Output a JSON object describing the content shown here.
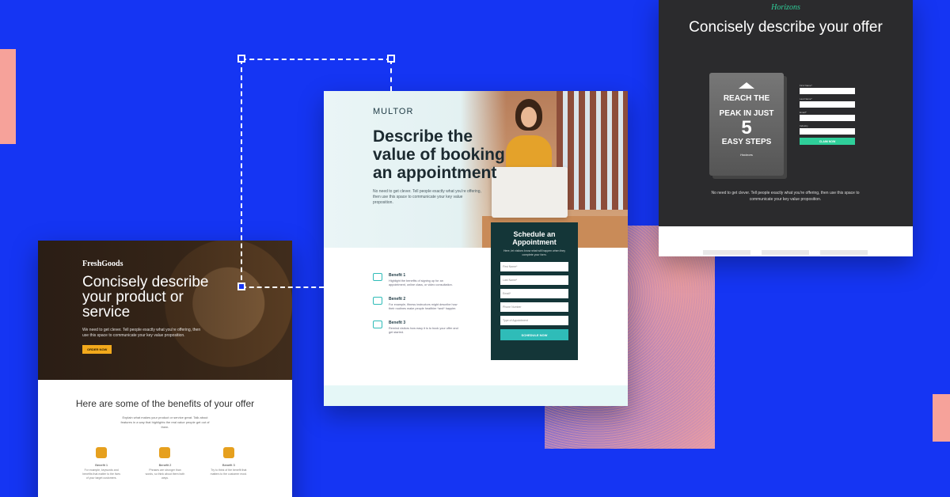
{
  "fresh": {
    "logo": "FreshGoods",
    "title": "Concisely describe your product or service",
    "subtitle": "We need to get clever. Tell people exactly what you're offering, then use this space to communicate your key value proposition.",
    "cta": "ORDER NOW",
    "benefits_heading": "Here are some of the benefits of your offer",
    "benefits_text": "Explain what makes your product or service great. Talk about features in a way that highlights the real value people get out of them.",
    "benefits": [
      {
        "title": "Benefit 1",
        "text": "For example, keywords and benefits that matter to the lives of your target customers."
      },
      {
        "title": "Benefit 2",
        "text": "Phrases are stronger than words, so think about them both ways."
      },
      {
        "title": "Benefit 3",
        "text": "Try to think of the benefit that matters to the customer most."
      }
    ]
  },
  "multor": {
    "logo": "MULTOR",
    "title": "Describe the value of booking an appointment",
    "subtitle": "No need to get clever. Tell people exactly what you're offering, then use this space to communicate your key value proposition.",
    "benefits": [
      {
        "title": "Benefit 1",
        "text": "Highlight the benefits of signing up for an appointment, online class, or video consultation."
      },
      {
        "title": "Benefit 2",
        "text": "For example, fitness instructors might describe how their routines make people healthier *and* happier."
      },
      {
        "title": "Benefit 3",
        "text": "Remind visitors how easy it is to book your offer and get started."
      }
    ],
    "form": {
      "title": "Schedule an Appointment",
      "subtitle": "Here, let visitors know what will happen when they complete your form.",
      "fields": [
        "First Name*",
        "Last Name*",
        "Email*",
        "Phone Number",
        "Type of Appointment"
      ],
      "button": "SCHEDULE NOW"
    }
  },
  "horizons": {
    "logo": "Horizons",
    "title": "Concisely describe your offer",
    "book": {
      "line1": "REACH THE",
      "line2": "PEAK IN JUST",
      "number": "5",
      "line3": "EASY STEPS",
      "brand": "Horizons"
    },
    "form": {
      "fields": [
        "First Name*",
        "Last Name*",
        "Email*",
        "Industry"
      ],
      "button": "CLAIM NOW"
    },
    "subtitle": "No need to get clever. Tell people exactly what you're offering, then use this space to communicate your key value proposition."
  },
  "colors": {
    "background": "#1535f3",
    "accent": "#f6a29a",
    "teal": "#2fbcb8",
    "green": "#2fcf9a"
  }
}
